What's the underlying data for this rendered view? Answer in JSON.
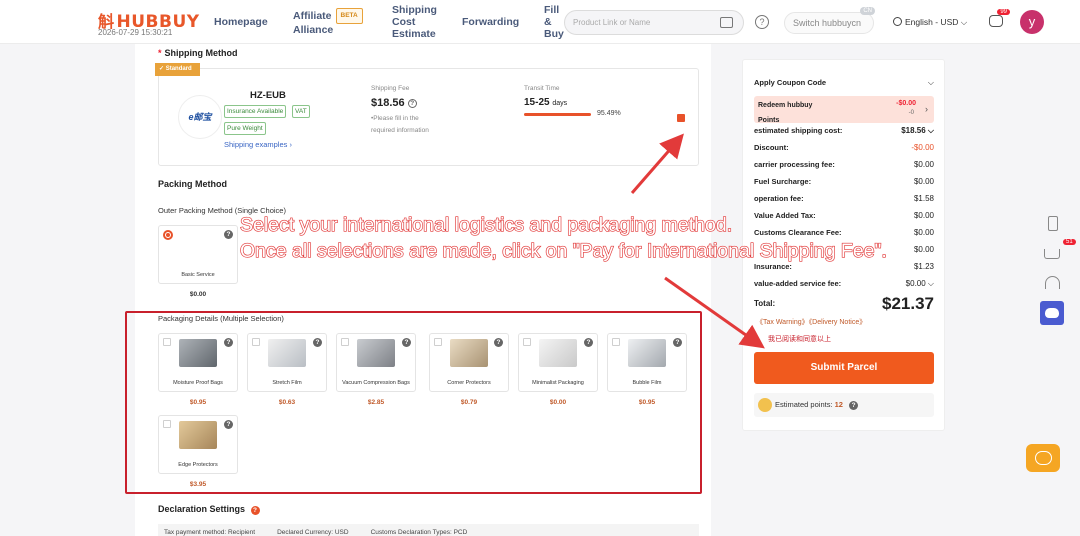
{
  "header": {
    "logo_mark": "斛",
    "logo_text": "HUBBUY",
    "timestamp": "2026-07-29 15:30:21",
    "nav": {
      "home": "Homepage",
      "affiliate_l1": "Affiliate",
      "affiliate_l2": "Alliance",
      "affiliate_badge": "BETA",
      "shipping_l1": "Shipping",
      "shipping_l2": "Cost",
      "shipping_l3": "Estimate",
      "forwarding": "Forwarding",
      "fill_l1": "Fill",
      "fill_l2": "&",
      "fill_l3": "Buy"
    },
    "search_placeholder": "Product Link or Name",
    "switch_label": "Switch hubbuycn",
    "switch_tag": "CN",
    "language": "English - USD",
    "message_badge": "99",
    "avatar_letter": "y"
  },
  "shipping": {
    "section_title": "Shipping Method",
    "required_mark": "*",
    "tag": "✓ Standard",
    "carrier_logo_text": "e邮宝",
    "carrier_name": "HZ-EUB",
    "pills": [
      "Insurance Available",
      "VAT",
      "Pure Weight"
    ],
    "examples_link": "Shipping examples",
    "fee_label": "Shipping Fee",
    "fee_value": "$18.56",
    "fee_note": "•Please fill in the required information",
    "transit_label": "Transit Time",
    "transit_value": "15-25",
    "transit_unit": "days",
    "transit_percent": "95.49%"
  },
  "packing": {
    "section_title": "Packing Method",
    "outer_label": "Outer Packing Method (Single Choice)",
    "basic_name": "Basic Service",
    "basic_price": "$0.00",
    "details_label": "Packaging Details (Multiple Selection)",
    "items": [
      {
        "name": "Moisture Proof Bags",
        "price": "$0.95"
      },
      {
        "name": "Stretch Film",
        "price": "$0.63"
      },
      {
        "name": "Vacuum Compression Bags",
        "price": "$2.85"
      },
      {
        "name": "Corner Protectors",
        "price": "$0.79"
      },
      {
        "name": "Minimalist Packaging",
        "price": "$0.00"
      },
      {
        "name": "Bubble Film",
        "price": "$0.95"
      },
      {
        "name": "Edge Protectors",
        "price": "$3.95"
      }
    ]
  },
  "declaration": {
    "section_title": "Declaration Settings",
    "tax_method": "Tax payment method: Recipient",
    "currency": "Declared Currency: USD",
    "types": "Customs Declaration Types: PCD"
  },
  "overlay": {
    "line1": "Select your international logistics and packaging method.",
    "line2": "Once all selections are made, click on \"Pay for International Shipping Fee\"."
  },
  "summary": {
    "coupon_label": "Apply Coupon Code",
    "redeem_label_l1": "Redeem hubbuy",
    "redeem_label_l2": "Points",
    "redeem_value": "-$0.00",
    "redeem_sub": "-0",
    "rows": [
      {
        "label": "estimated shipping cost:",
        "value": "$18.56"
      },
      {
        "label": "Discount:",
        "value": "-$0.00"
      },
      {
        "label": "carrier processing fee:",
        "value": "$0.00"
      },
      {
        "label": "Fuel Surcharge:",
        "value": "$0.00"
      },
      {
        "label": "operation fee:",
        "value": "$1.58"
      },
      {
        "label": "Value Added Tax:",
        "value": "$0.00"
      },
      {
        "label": "Customs Clearance Fee:",
        "value": "$0.00"
      },
      {
        "label": "",
        "value": "$0.00"
      },
      {
        "label": "Insurance:",
        "value": "$1.23"
      },
      {
        "label": "value-added service fee:",
        "value": "$0.00"
      }
    ],
    "total_label": "Total:",
    "total_value": "$21.37",
    "links": "《Tax Warning》《Delivery Notice》",
    "agree_text": "我已阅读和同意以上",
    "submit_label": "Submit Parcel",
    "points_label": "Estimated points:",
    "points_value": "12"
  },
  "side": {
    "cart_badge": "51"
  },
  "colors": {
    "brand_orange": "#f05a1e",
    "annotation_red": "#e23a3a",
    "box_red": "#c8202c"
  }
}
